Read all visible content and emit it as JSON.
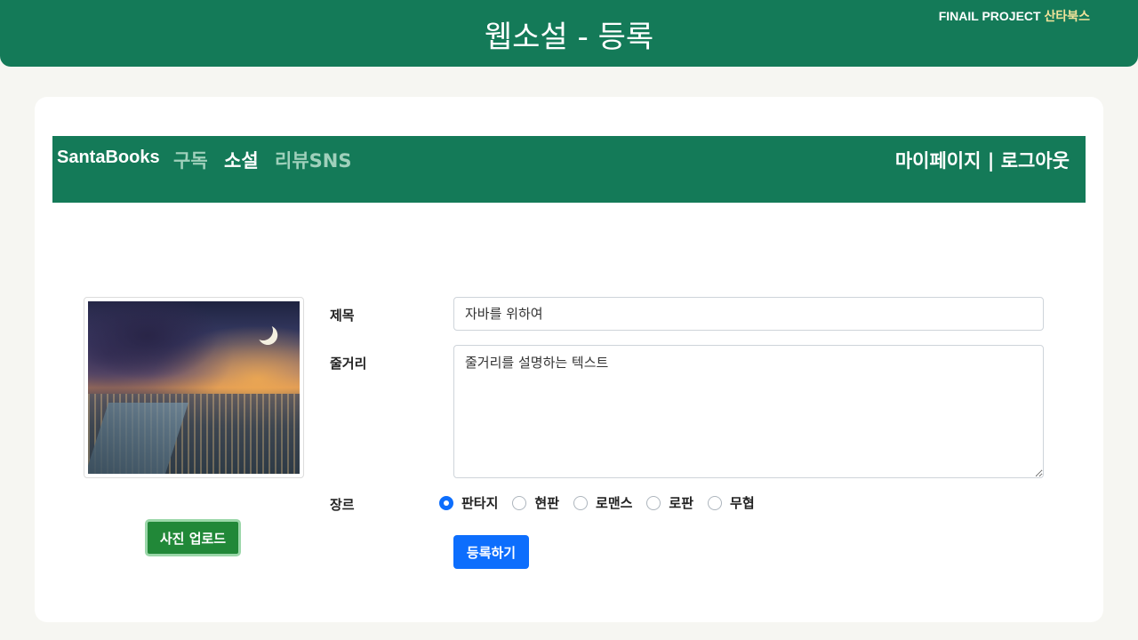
{
  "header": {
    "title": "웹소설 - 등록",
    "project_prefix": "FINAIL PROJECT",
    "project_name": "산타북스"
  },
  "nav": {
    "brand": "SantaBooks",
    "links": [
      {
        "label": "구독",
        "active": false
      },
      {
        "label": "소설",
        "active": true
      },
      {
        "label": "리뷰SNS",
        "active": false
      }
    ],
    "mypage": "마이페이지",
    "separator": " | ",
    "logout": "로그아웃"
  },
  "photo": {
    "upload_label": "사진 업로드"
  },
  "form": {
    "title_label": "제목",
    "title_value": "자바를 위하여",
    "synopsis_label": "줄거리",
    "synopsis_value": "줄거리를 설명하는 텍스트",
    "genre_label": "장르",
    "genres": [
      {
        "label": "판타지",
        "checked": true
      },
      {
        "label": "현판",
        "checked": false
      },
      {
        "label": "로맨스",
        "checked": false
      },
      {
        "label": "로판",
        "checked": false
      },
      {
        "label": "무협",
        "checked": false
      }
    ],
    "genre_selected": "판타지",
    "submit_label": "등록하기"
  },
  "colors": {
    "brand_green": "#147a58",
    "upload_green": "#218838",
    "primary_blue": "#0d6efd",
    "accent_yellow": "#f1e39a"
  }
}
